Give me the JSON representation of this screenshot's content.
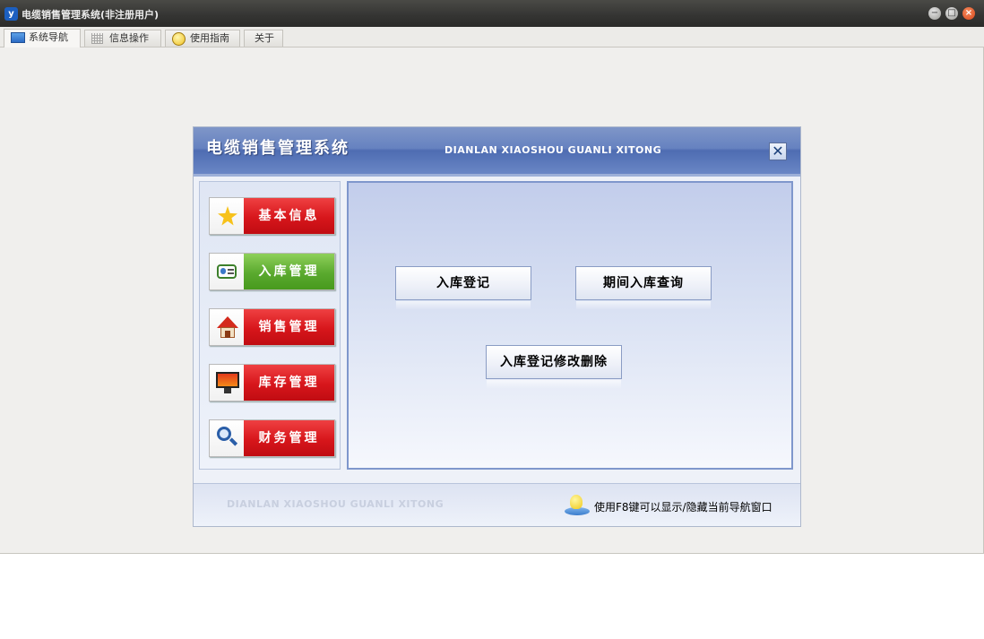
{
  "window": {
    "title": "电缆销售管理系统(非注册用户)",
    "app_icon": "yf-logo-icon"
  },
  "tabs": [
    {
      "label": "系统导航",
      "icon": "monitor-icon",
      "active": true
    },
    {
      "label": "信息操作",
      "icon": "grid-icon",
      "active": false
    },
    {
      "label": "使用指南",
      "icon": "help-icon",
      "active": false
    },
    {
      "label": "关于",
      "icon": "",
      "active": false
    }
  ],
  "nav_panel": {
    "title": "电缆销售管理系统",
    "subtitle": "DIANLAN XIAOSHOU GUANLI XITONG",
    "close_glyph": "✕",
    "menu": [
      {
        "label": "基本信息",
        "icon": "star-icon",
        "color": "#d7161b"
      },
      {
        "label": "入库管理",
        "icon": "contact-card-icon",
        "color": "#5aa92e",
        "selected": true
      },
      {
        "label": "销售管理",
        "icon": "house-icon",
        "color": "#d7161b"
      },
      {
        "label": "库存管理",
        "icon": "monitor-icon",
        "color": "#d7161b"
      },
      {
        "label": "财务管理",
        "icon": "magnifier-icon",
        "color": "#d7161b"
      }
    ],
    "actions": {
      "register": "入库登记",
      "period_query": "期间入库查询",
      "edit_delete": "入库登记修改删除"
    },
    "footer": {
      "watermark": "DIANLAN XIAOSHOU GUANLI XITONG",
      "tip": "使用F8键可以显示/隐藏当前导航窗口",
      "tip_icon": "lightbulb-icon"
    }
  }
}
